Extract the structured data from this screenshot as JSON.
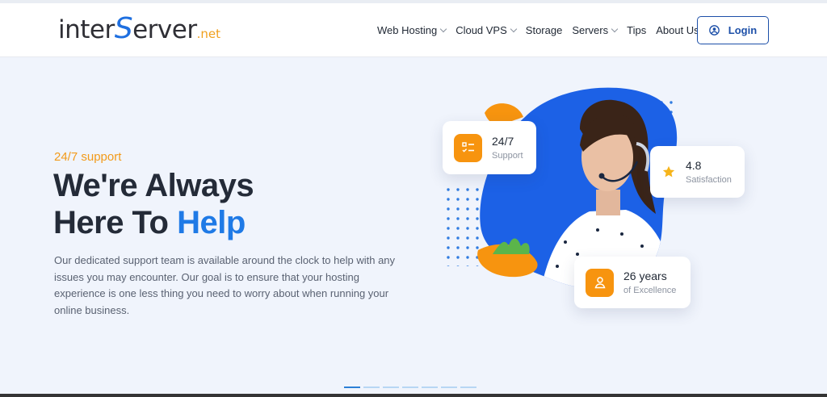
{
  "header": {
    "logo": {
      "part1": "inter",
      "part2": "S",
      "part3": "erver",
      "part4": ".net"
    },
    "nav": [
      {
        "label": "Web Hosting",
        "has_dropdown": true
      },
      {
        "label": "Cloud VPS",
        "has_dropdown": true
      },
      {
        "label": "Storage",
        "has_dropdown": false
      },
      {
        "label": "Servers",
        "has_dropdown": true
      },
      {
        "label": "Tips",
        "has_dropdown": false
      },
      {
        "label": "About Us",
        "has_dropdown": true
      }
    ],
    "login_label": "Login",
    "login_icon": "user-circle-icon"
  },
  "hero": {
    "eyebrow": "24/7 support",
    "headline_line1": "We're Always",
    "headline_line2_prefix": "Here To ",
    "headline_line2_accent": "Help",
    "description": "Our dedicated support team is available around the clock to help with any issues you may encounter. Our goal is to ensure that your hosting experience is one less thing you need to worry about when running your online business.",
    "cards": {
      "support": {
        "title": "24/7",
        "subtitle": "Support",
        "icon": "checklist-icon"
      },
      "satisfaction": {
        "title": "4.8",
        "subtitle": "Satisfaction",
        "icon": "star-icon"
      },
      "years": {
        "title": "26 years",
        "subtitle": "of Excellence",
        "icon": "user-icon"
      }
    }
  },
  "slider": {
    "count": 7,
    "active_index": 0
  },
  "colors": {
    "brand_blue": "#1e6fe0",
    "accent_orange": "#f7940f",
    "headline_dark": "#242b38",
    "hero_bg": "#f0f4fc"
  }
}
